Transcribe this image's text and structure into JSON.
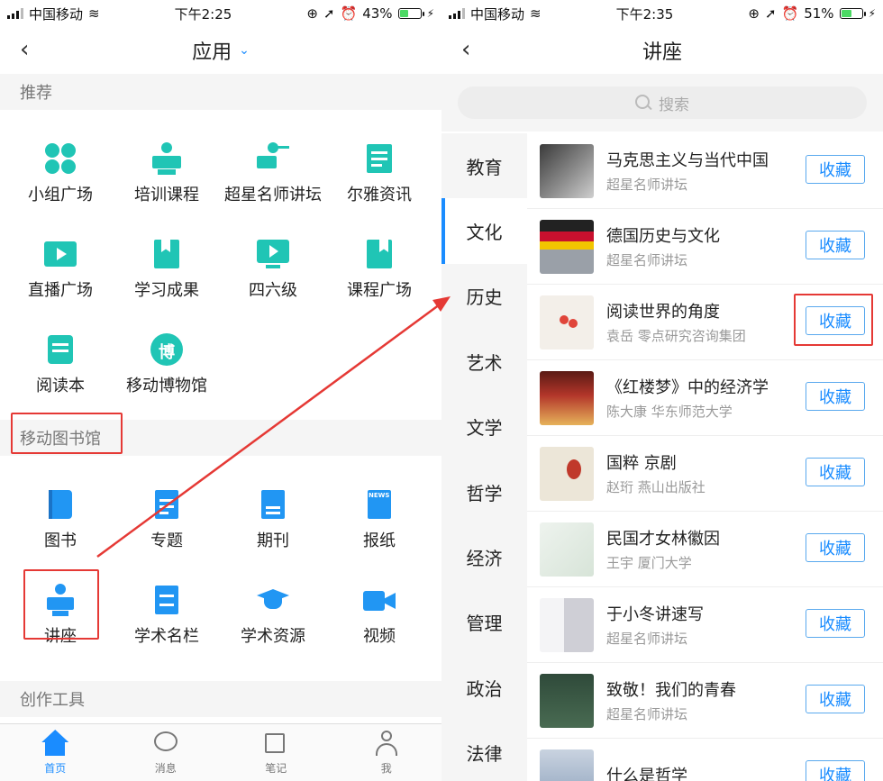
{
  "left": {
    "status": {
      "carrier": "中国移动",
      "time": "下午2:25",
      "battery": "43%",
      "battery_level": 0.43
    },
    "nav": {
      "title": "应用",
      "caret": "⌄"
    },
    "sections": {
      "recommend": "推荐",
      "library": "移动图书馆",
      "tools": "创作工具"
    },
    "recommend_items": [
      "小组广场",
      "培训课程",
      "超星名师讲坛",
      "尔雅资讯",
      "直播广场",
      "学习成果",
      "四六级",
      "课程广场",
      "阅读本",
      "移动博物馆"
    ],
    "library_items": [
      "图书",
      "专题",
      "期刊",
      "报纸",
      "讲座",
      "学术名栏",
      "学术资源",
      "视频"
    ],
    "museum_glyph": "博",
    "news_glyph": "NEWS",
    "tabs": [
      "首页",
      "消息",
      "笔记",
      "我"
    ]
  },
  "right": {
    "status": {
      "carrier": "中国移动",
      "time": "下午2:35",
      "battery": "51%",
      "battery_level": 0.51
    },
    "nav": {
      "title": "讲座"
    },
    "search": {
      "placeholder": "搜索"
    },
    "categories": [
      "教育",
      "文化",
      "历史",
      "艺术",
      "文学",
      "哲学",
      "经济",
      "管理",
      "政治",
      "法律"
    ],
    "active_category": "文化",
    "fav_label": "收藏",
    "items": [
      {
        "title": "马克思主义与当代中国",
        "sub": "超星名师讲坛"
      },
      {
        "title": "德国历史与文化",
        "sub": "超星名师讲坛"
      },
      {
        "title": "阅读世界的角度",
        "sub": "袁岳 零点研究咨询集团"
      },
      {
        "title": "《红楼梦》中的经济学",
        "sub": "陈大康 华东师范大学"
      },
      {
        "title": "国粹 京剧",
        "sub": "赵珩 燕山出版社"
      },
      {
        "title": "民国才女林徽因",
        "sub": "王宇 厦门大学"
      },
      {
        "title": "于小冬讲速写",
        "sub": "超星名师讲坛"
      },
      {
        "title": "致敬！我们的青春",
        "sub": "超星名师讲坛"
      },
      {
        "title": "什么是哲学",
        "sub": ""
      }
    ]
  },
  "colors": {
    "accent": "#1a8cff",
    "teal": "#20c5b5",
    "blue": "#2196f3",
    "highlight": "#e53935"
  }
}
